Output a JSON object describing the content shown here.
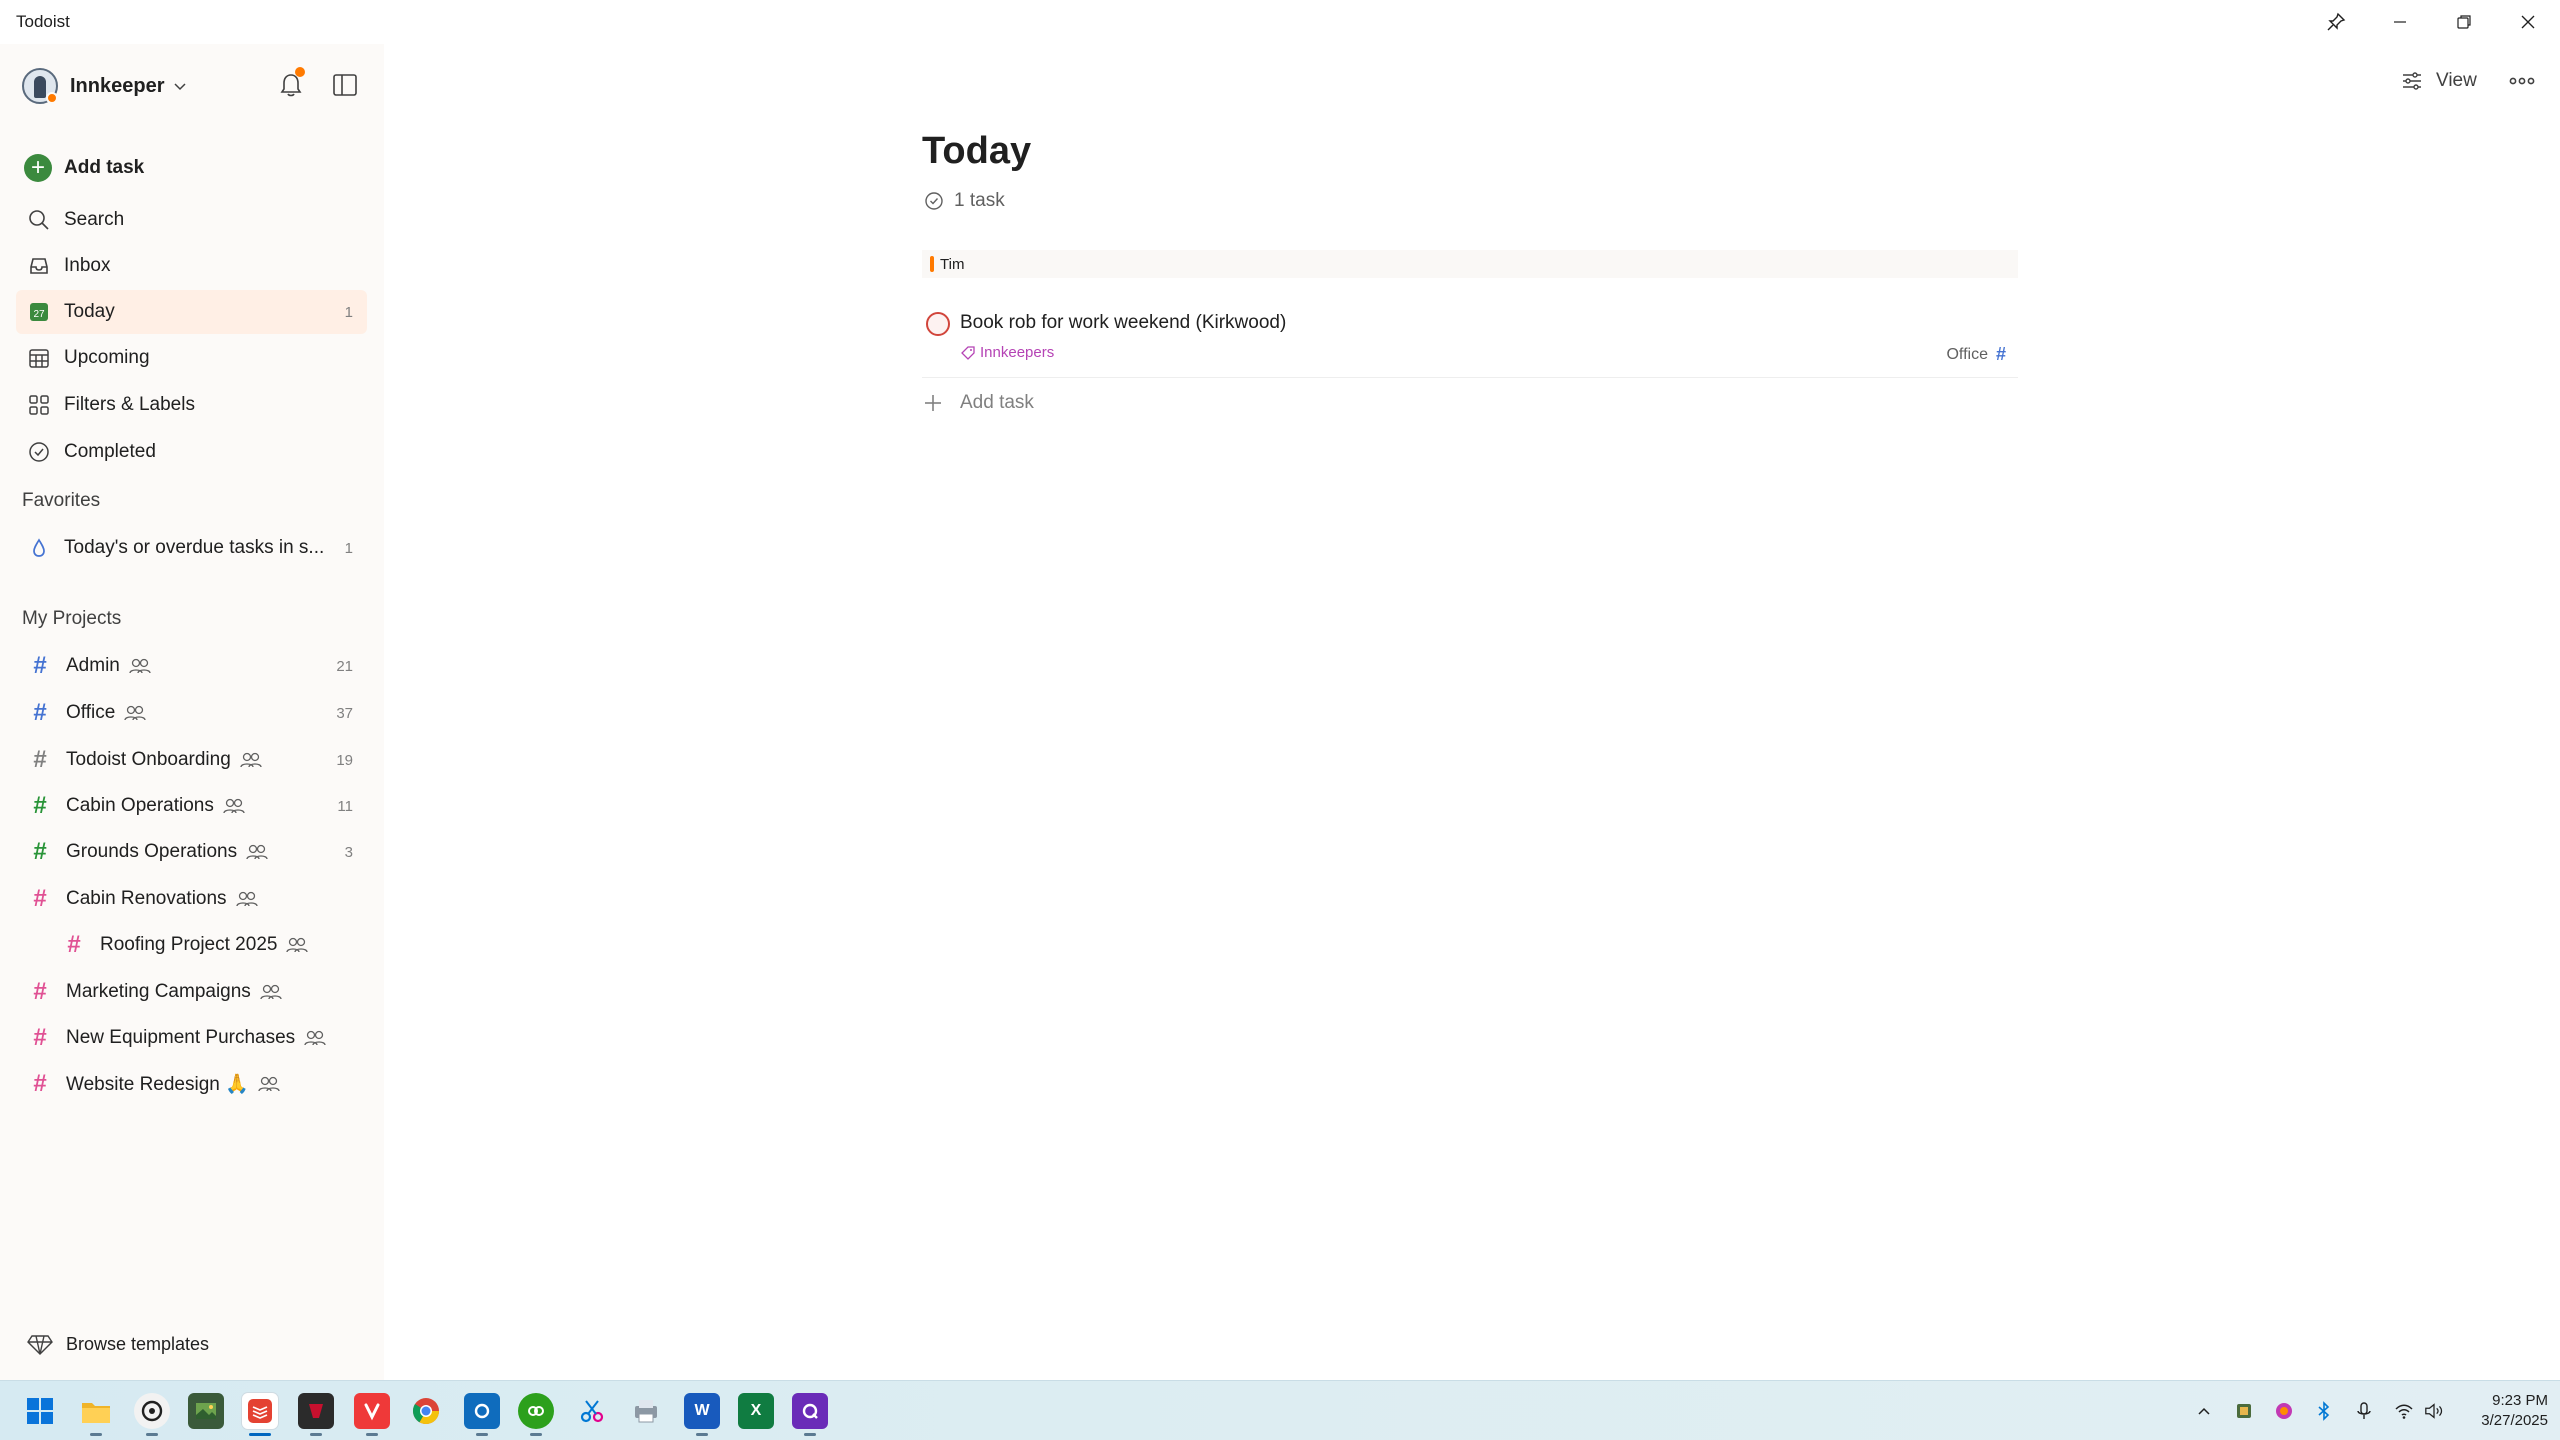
{
  "window": {
    "title": "Todoist"
  },
  "sidebar": {
    "user": {
      "name": "Innkeeper"
    },
    "nav": [
      {
        "label": "Add task"
      },
      {
        "label": "Search"
      },
      {
        "label": "Inbox"
      },
      {
        "label": "Today",
        "count": "1",
        "date_icon_text": "27"
      },
      {
        "label": "Upcoming"
      },
      {
        "label": "Filters & Labels"
      },
      {
        "label": "Completed"
      }
    ],
    "favorites": {
      "heading": "Favorites",
      "items": [
        {
          "label": "Today's or overdue tasks in s...",
          "count": "1"
        }
      ]
    },
    "projects": {
      "heading": "My Projects",
      "items": [
        {
          "label": "Admin",
          "count": "21",
          "color": "#4573d2"
        },
        {
          "label": "Office",
          "count": "37",
          "color": "#4573d2"
        },
        {
          "label": "Todoist Onboarding",
          "count": "19",
          "color": "#808080"
        },
        {
          "label": "Cabin Operations",
          "count": "11",
          "color": "#299438"
        },
        {
          "label": "Grounds Operations",
          "count": "3",
          "color": "#299438"
        },
        {
          "label": "Cabin Renovations",
          "count": "",
          "color": "#e05194"
        },
        {
          "label": "Roofing Project 2025",
          "count": "",
          "color": "#e05194"
        },
        {
          "label": "Marketing Campaigns",
          "count": "",
          "color": "#e05194"
        },
        {
          "label": "New Equipment Purchases",
          "count": "",
          "color": "#e05194"
        },
        {
          "label": "Website Redesign 🙏",
          "count": "",
          "color": "#e05194"
        }
      ]
    },
    "browse_templates": "Browse templates"
  },
  "header": {
    "view_label": "View"
  },
  "main": {
    "title": "Today",
    "task_count": "1 task",
    "group": {
      "name": "Tim"
    },
    "tasks": [
      {
        "title": "Book rob for work weekend (Kirkwood)",
        "label": "Innkeepers",
        "project": "Office"
      }
    ],
    "add_task_label": "Add task"
  },
  "taskbar": {
    "time": "9:23 PM",
    "date": "3/27/2025"
  },
  "colors": {
    "accent": "#dc4c3e",
    "active_bg": "#ffefe5",
    "add_green": "#3b8a3e",
    "label_purple": "#b543b5"
  }
}
